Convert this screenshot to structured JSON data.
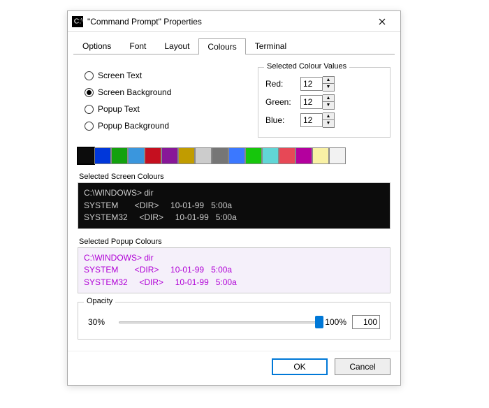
{
  "window": {
    "title": "\"Command Prompt\" Properties"
  },
  "tabs": [
    "Options",
    "Font",
    "Layout",
    "Colours",
    "Terminal"
  ],
  "active_tab": "Colours",
  "radios": {
    "screen_text": "Screen Text",
    "screen_background": "Screen Background",
    "popup_text": "Popup Text",
    "popup_background": "Popup Background",
    "selected": "screen_background"
  },
  "colour_values": {
    "legend": "Selected Colour Values",
    "red_label": "Red:",
    "green_label": "Green:",
    "blue_label": "Blue:",
    "red": "12",
    "green": "12",
    "blue": "12"
  },
  "palette": [
    "#0c0c0c",
    "#0037da",
    "#13a10e",
    "#3a96dd",
    "#c50f1f",
    "#881798",
    "#c19c00",
    "#cccccc",
    "#767676",
    "#3b78ff",
    "#16c60c",
    "#61d6d6",
    "#e74856",
    "#b4009e",
    "#f9f1a5",
    "#f2f2f2"
  ],
  "palette_selected_index": 0,
  "screen_preview": {
    "legend": "Selected Screen Colours",
    "line1": "C:\\WINDOWS> dir",
    "line2": "SYSTEM       <DIR>     10-01-99   5:00a",
    "line3": "SYSTEM32     <DIR>     10-01-99   5:00a"
  },
  "popup_preview": {
    "legend": "Selected Popup Colours",
    "line1": "C:\\WINDOWS> dir",
    "line2": "SYSTEM       <DIR>     10-01-99   5:00a",
    "line3": "SYSTEM32     <DIR>     10-01-99   5:00a"
  },
  "opacity": {
    "legend": "Opacity",
    "min_label": "30%",
    "max_label": "100%",
    "value": "100",
    "percent": 100
  },
  "buttons": {
    "ok": "OK",
    "cancel": "Cancel"
  }
}
